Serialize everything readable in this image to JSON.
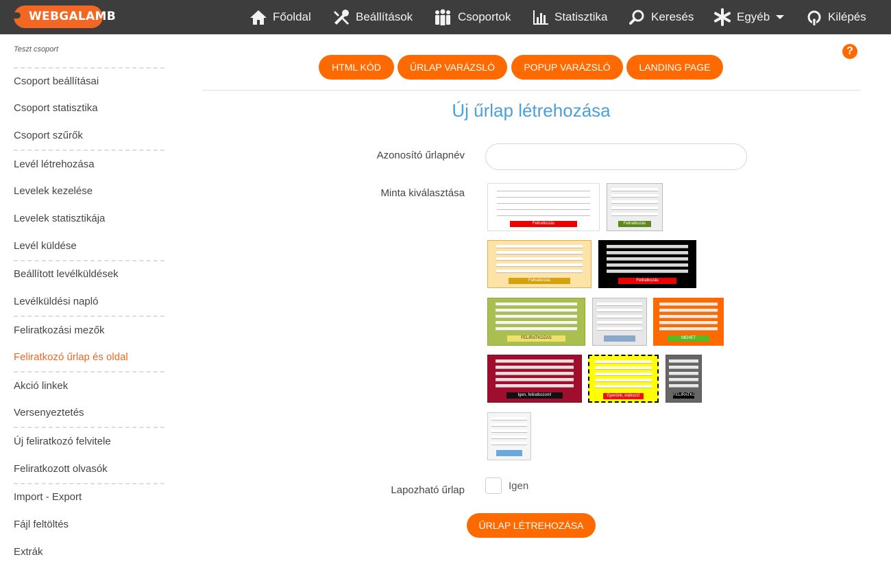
{
  "topbar": {
    "logo": "WEBGALAMB",
    "nav": [
      {
        "label": "Főoldal",
        "icon": "home-icon"
      },
      {
        "label": "Beállítások",
        "icon": "tools-icon"
      },
      {
        "label": "Csoportok",
        "icon": "group-icon"
      },
      {
        "label": "Statisztika",
        "icon": "bar-chart-icon"
      },
      {
        "label": "Keresés",
        "icon": "search-icon"
      },
      {
        "label": "Egyéb",
        "icon": "asterisk-icon"
      },
      {
        "label": "Kilépés",
        "icon": "power-icon"
      }
    ]
  },
  "sidebar": {
    "group_title": "Teszt csoport",
    "items": [
      {
        "label": "Csoport beállításai"
      },
      {
        "label": "Csoport statisztika"
      },
      {
        "label": "Csoport szűrők"
      },
      {
        "label": "Levél létrehozása"
      },
      {
        "label": "Levelek kezelése"
      },
      {
        "label": "Levelek statisztikája"
      },
      {
        "label": "Levél küldése"
      },
      {
        "label": "Beállított levélküldések"
      },
      {
        "label": "Levélküldési napló"
      },
      {
        "label": "Feliratkozási mezők"
      },
      {
        "label": "Feliratkozó űrlap és oldal",
        "active": true
      },
      {
        "label": "Akció linkek"
      },
      {
        "label": "Versenyeztetés"
      },
      {
        "label": "Új feliratkozó felvitele"
      },
      {
        "label": "Feliratkozott olvasók"
      },
      {
        "label": "Import - Export"
      },
      {
        "label": "Fájl feltöltés"
      },
      {
        "label": "Extrák"
      }
    ]
  },
  "tabs": [
    {
      "label": "HTML KÓD"
    },
    {
      "label": "ŰRLAP VARÁZSLÓ"
    },
    {
      "label": "POPUP VARÁZSLÓ"
    },
    {
      "label": "LANDING PAGE"
    }
  ],
  "help": "?",
  "form": {
    "title": "Új űrlap létrehozása",
    "name_label": "Azonosító űrlapnév",
    "name_value": "",
    "template_label": "Minta kiválasztása",
    "paging_label": "Lapozható űrlap",
    "paging_option": "Igen",
    "submit_label": "ŰRLAP LÉTREHOZÁSA"
  },
  "templates": [
    {
      "name": "template-white",
      "bg": "#ffffff",
      "border": "#dddddd",
      "button": "#ee0000",
      "button_text": "Feliratkozás"
    },
    {
      "name": "template-grey-green",
      "bg": "#eeeeee",
      "border": "#bbbbbb",
      "button": "#5e8a1c",
      "button_text": "Feliratkozás"
    },
    {
      "name": "template-cream",
      "bg": "#fde3a7",
      "border": "#e0b040",
      "button": "#d4a20a",
      "button_text": "Feliratkozás"
    },
    {
      "name": "template-black",
      "bg": "#000000",
      "border": "#000000",
      "button": "#ee0000",
      "button_text": "Feliratkozás"
    },
    {
      "name": "template-olive",
      "bg": "#a9bf4f",
      "border": "#8ea33a",
      "button": "#f0e06a",
      "button_text": "FELIRATKOZÁS"
    },
    {
      "name": "template-light-grey",
      "bg": "#e6e6e6",
      "border": "#bbbbbb",
      "button": "#8aa8cc",
      "button_text": ""
    },
    {
      "name": "template-orange",
      "bg": "#ff6a00",
      "border": "#ff6a00",
      "button": "#55bb22",
      "button_text": "MEHET"
    },
    {
      "name": "template-maroon",
      "bg": "#a10e2d",
      "border": "#7d0a22",
      "button": "#111111",
      "button_text": "Igen, feliratkozom!"
    },
    {
      "name": "template-yellow",
      "bg": "#ffff00",
      "border": "#000000",
      "button": "#ee1111",
      "button_text": "Gyerünk, iratkozz!"
    },
    {
      "name": "template-dark-grey",
      "bg": "#666666",
      "border": "#555555",
      "button": "#000000",
      "button_text": "FELIRATKOZÁS"
    },
    {
      "name": "template-plain",
      "bg": "#f5f5f5",
      "border": "#cccccc",
      "button": "#6aa8e0",
      "button_text": ""
    }
  ],
  "colors": {
    "accent": "#ff6a00",
    "title": "#4aa0d8",
    "topbar": "#3d3d3d"
  }
}
